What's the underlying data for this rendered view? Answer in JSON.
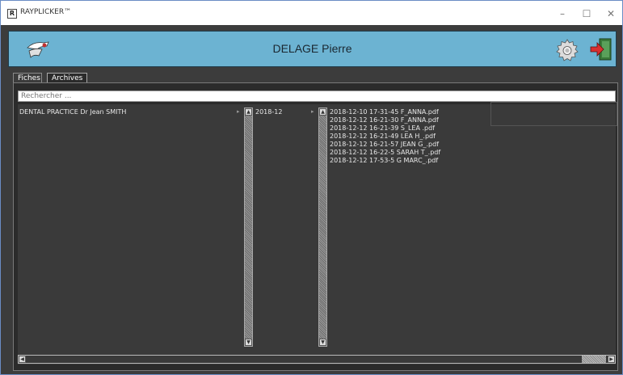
{
  "window": {
    "app_icon": "R",
    "title": "RAYPLICKER™",
    "minimize": "–",
    "maximize": "☐",
    "close": "✕"
  },
  "header": {
    "patient_name": "DELAGE Pierre",
    "icons": [
      "logo-icon",
      "gear-icon",
      "exit-icon"
    ]
  },
  "tabs": [
    {
      "label": "Fiches",
      "active": false
    },
    {
      "label": "Archives",
      "active": true
    }
  ],
  "search": {
    "placeholder": "Rechercher ..."
  },
  "columns": {
    "practice": "DENTAL PRACTICE Dr Jean SMITH",
    "month": "2018-12",
    "files": [
      "2018-12-10 17-31-45 F_ANNA.pdf",
      "2018-12-12 16-21-30 F_ANNA.pdf",
      "2018-12-12 16-21-39 S_LEA .pdf",
      "2018-12-12 16-21-49 LEA H_.pdf",
      "2018-12-12 16-21-57 JEAN G_.pdf",
      "2018-12-12 16-22-5 SARAH T_.pdf",
      "2018-12-12 17-53-5 G MARC_.pdf"
    ]
  },
  "colors": {
    "banner": "#6cb3d2",
    "background": "#3c3c3c"
  }
}
